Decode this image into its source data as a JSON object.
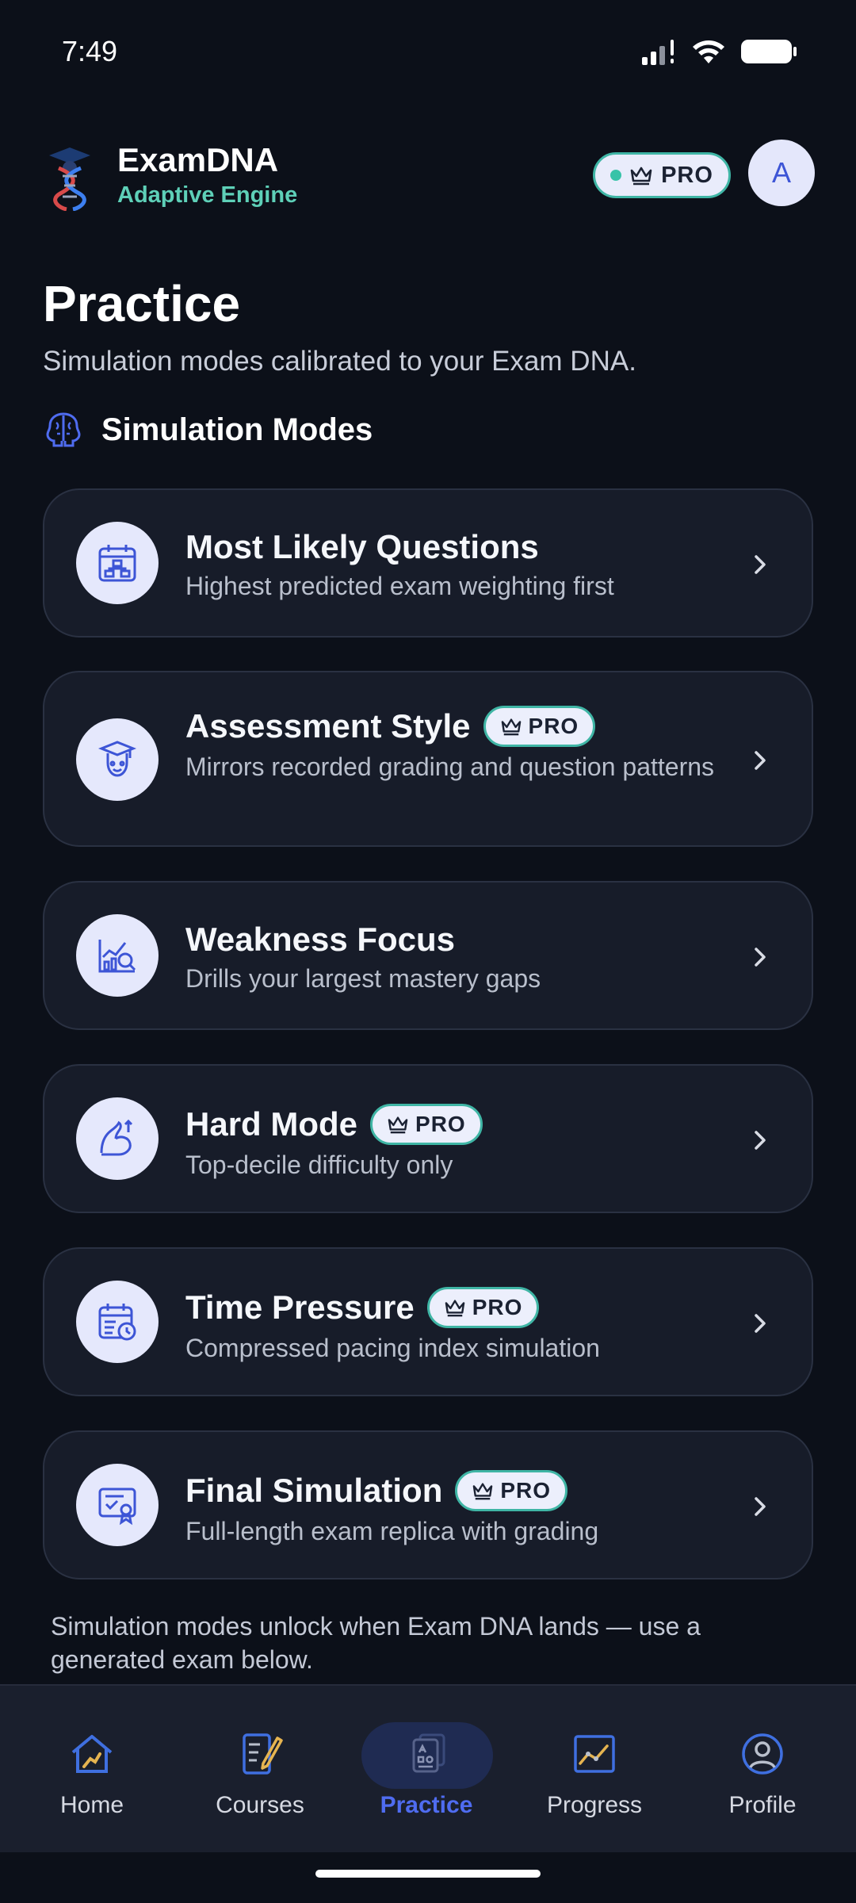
{
  "status_bar": {
    "time": "7:49"
  },
  "header": {
    "app_name": "ExamDNA",
    "tagline": "Adaptive Engine",
    "pro_label": "PRO",
    "avatar_initial": "A"
  },
  "page": {
    "title": "Practice",
    "subtitle": "Simulation modes calibrated to your Exam DNA.",
    "section_title": "Simulation Modes"
  },
  "modes": [
    {
      "title": "Most Likely Questions",
      "description": "Highest predicted exam weighting first",
      "pro": false,
      "icon": "calendar-chart-icon"
    },
    {
      "title": "Assessment Style",
      "description": "Mirrors recorded grading and question patterns",
      "pro": true,
      "icon": "graduate-icon"
    },
    {
      "title": "Weakness Focus",
      "description": "Drills your largest mastery gaps",
      "pro": false,
      "icon": "chart-magnifier-icon"
    },
    {
      "title": "Hard Mode",
      "description": "Top-decile difficulty only",
      "pro": true,
      "icon": "flexed-arm-icon"
    },
    {
      "title": "Time Pressure",
      "description": "Compressed pacing index simulation",
      "pro": true,
      "icon": "calendar-clock-icon"
    },
    {
      "title": "Final Simulation",
      "description": "Full-length exam replica with grading",
      "pro": true,
      "icon": "certificate-icon"
    }
  ],
  "pro_badge_label": "PRO",
  "footer_note": "Simulation modes unlock when Exam DNA lands — use a generated exam below.",
  "bottom_nav": [
    {
      "label": "Home",
      "icon": "home-icon",
      "active": false
    },
    {
      "label": "Courses",
      "icon": "notebook-pencil-icon",
      "active": false
    },
    {
      "label": "Practice",
      "icon": "practice-cards-icon",
      "active": true
    },
    {
      "label": "Progress",
      "icon": "progress-chart-icon",
      "active": false
    },
    {
      "label": "Profile",
      "icon": "profile-icon",
      "active": false
    }
  ],
  "colors": {
    "background": "#0c1019",
    "card": "#171c29",
    "accent_teal": "#5ed0b8",
    "accent_blue": "#4f6cf0"
  }
}
